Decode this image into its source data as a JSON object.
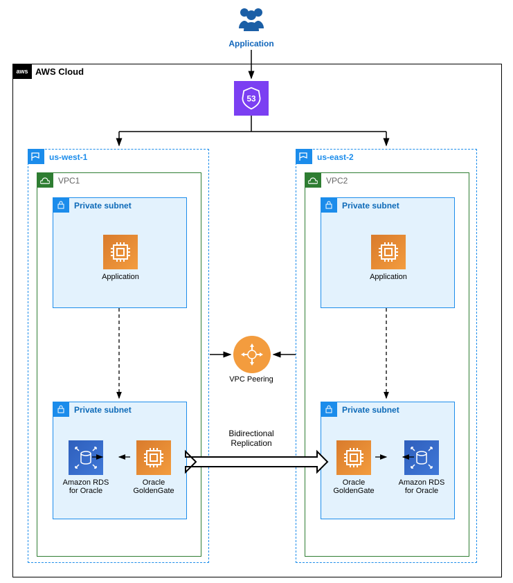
{
  "top": {
    "application_label": "Application"
  },
  "cloud": {
    "badge": "aws",
    "title": "AWS Cloud"
  },
  "route53": {
    "text": "53"
  },
  "regions": {
    "left": {
      "name": "us-west-1"
    },
    "right": {
      "name": "us-east-2"
    }
  },
  "vpcs": {
    "left": {
      "name": "VPC1"
    },
    "right": {
      "name": "VPC2"
    }
  },
  "subnet_label": "Private subnet",
  "app_label": "Application",
  "rds_label_line1": "Amazon RDS",
  "rds_label_line2": "for Oracle",
  "gg_label_line1": "Oracle",
  "gg_label_line2": "GoldenGate",
  "peering_label": "VPC Peering",
  "replication_line1": "Bidirectional",
  "replication_line2": "Replication"
}
